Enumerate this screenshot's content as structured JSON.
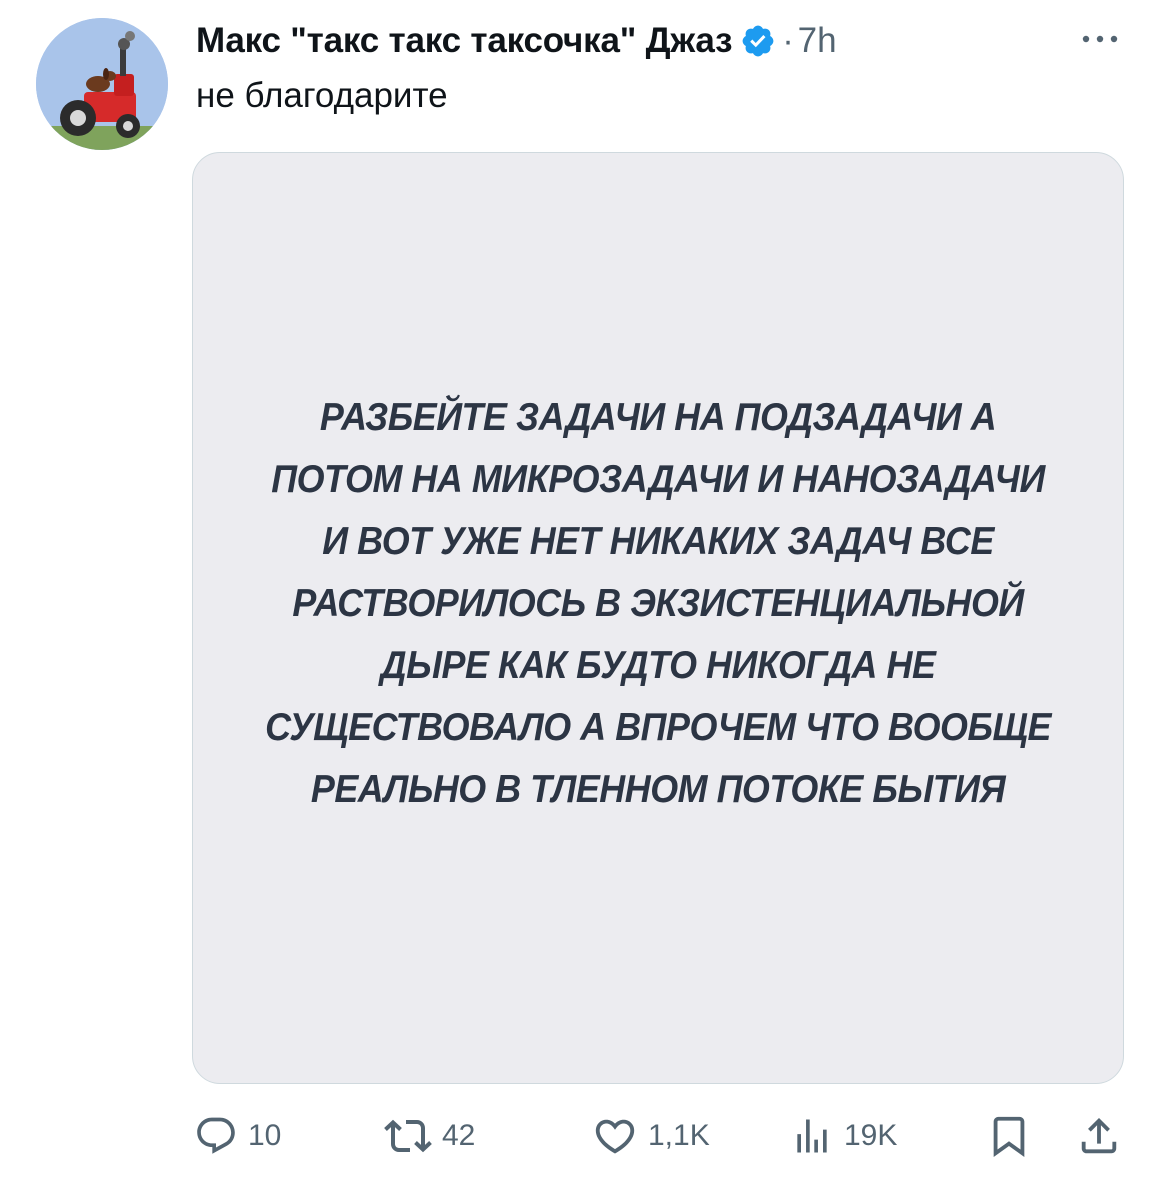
{
  "tweet": {
    "display_name": "Макс \"такс такс таксочка\" Джаз",
    "separator": "·",
    "time": "7h",
    "text": "не благодарите",
    "verified_color": "#1d9bf0",
    "avatar_icon": "dachshund-on-tractor-avatar",
    "media": {
      "lines": [
        "РАЗБЕЙТЕ ЗАДАЧИ НА ПОДЗАДАЧИ А",
        "ПОТОМ НА МИКРОЗАДАЧИ И НАНОЗАДАЧИ",
        "И ВОТ УЖЕ НЕТ НИКАКИХ ЗАДАЧ ВСЕ",
        "РАСТВОРИЛОСЬ В ЭКЗИСТЕНЦИАЛЬНОЙ",
        "ДЫРЕ КАК БУДТО НИКОГДА НЕ",
        "СУЩЕСТВОВАЛО А ВПРОЧЕМ ЧТО ВООБЩЕ",
        "РЕАЛЬНО В ТЛЕННОМ ПОТОКЕ БЫТИЯ"
      ],
      "background_color": "#ececf0",
      "text_color": "#2c3544"
    },
    "actions": {
      "replies": "10",
      "reposts": "42",
      "likes": "1,1K",
      "views": "19K"
    }
  }
}
